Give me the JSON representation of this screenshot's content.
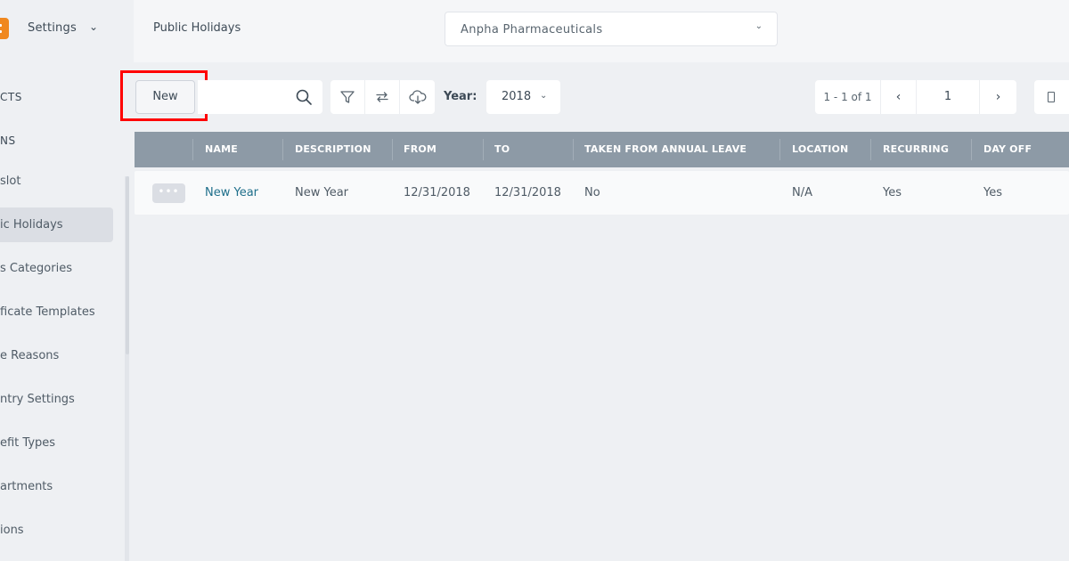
{
  "app": {
    "title": "Settings",
    "page_title": "Public Holidays",
    "company": "Anpha Pharmaceuticals"
  },
  "sidebar": {
    "items": [
      {
        "label": "CTS"
      },
      {
        "label": "NS"
      },
      {
        "label": "slot"
      },
      {
        "label": "ic Holidays"
      },
      {
        "label": "s Categories"
      },
      {
        "label": "ficate Templates"
      },
      {
        "label": "e Reasons"
      },
      {
        "label": "ntry Settings"
      },
      {
        "label": "efit Types"
      },
      {
        "label": "artments"
      },
      {
        "label": "ions"
      }
    ]
  },
  "toolbar": {
    "new_label": "New",
    "year_label": "Year:",
    "year_value": "2018",
    "pager_count": "1 - 1 of 1",
    "pager_page": "1"
  },
  "table": {
    "columns": [
      "NAME",
      "DESCRIPTION",
      "FROM",
      "TO",
      "TAKEN FROM ANNUAL LEAVE",
      "LOCATION",
      "RECURRING",
      "DAY OFF"
    ],
    "rows": [
      {
        "name": "New Year",
        "description": "New Year",
        "from": "12/31/2018",
        "to": "12/31/2018",
        "taken": "No",
        "location": "N/A",
        "recurring": "Yes",
        "day_off": "Yes"
      }
    ]
  },
  "colors": {
    "accent": "#f0881f",
    "highlight": "#ff0000",
    "header_bg": "#8d9aa6",
    "link": "#1f6f8b"
  },
  "icons": [
    "logo-icon",
    "chevron-down-icon",
    "search-icon",
    "filter-icon",
    "sync-icon",
    "download-icon",
    "chevron-left-icon",
    "chevron-right-icon",
    "view-toggle-icon",
    "more-icon"
  ]
}
